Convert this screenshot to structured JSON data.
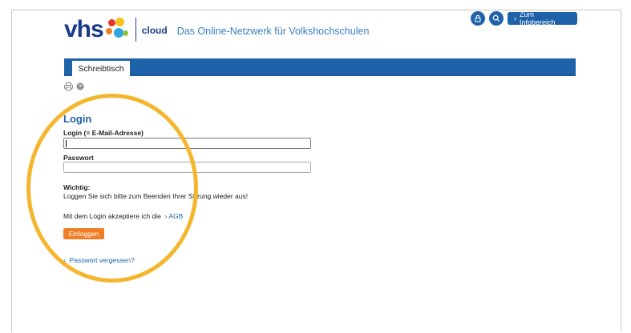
{
  "brand": {
    "wordmark": "vhs",
    "product": "cloud",
    "tagline": "Das Online-Netzwerk für Volkshochschulen"
  },
  "top_bar": {
    "icons": [
      "lock-icon",
      "search-icon"
    ],
    "info_button_label": "Zum Infobereich"
  },
  "nav": {
    "tabs": [
      {
        "label": "Schreibtisch",
        "active": true
      }
    ],
    "accent_color": "#1e63a9"
  },
  "tools": [
    "print-icon",
    "help-icon"
  ],
  "login": {
    "title": "Login",
    "email_label": "Login (= E-Mail-Adresse)",
    "email_value": "",
    "password_label": "Passwort",
    "password_value": "",
    "notice_heading": "Wichtig:",
    "notice_text": "Loggen Sie sich bitte zum Beenden Ihrer Sitzung wieder aus!",
    "terms_text": "Mit dem Login akzeptiere ich die",
    "terms_link": "AGB",
    "submit_label": "Einloggen",
    "forgot_link": "Passwort vergessen?",
    "button_color": "#f07e26"
  },
  "highlight": {
    "color": "#f4b62e"
  }
}
